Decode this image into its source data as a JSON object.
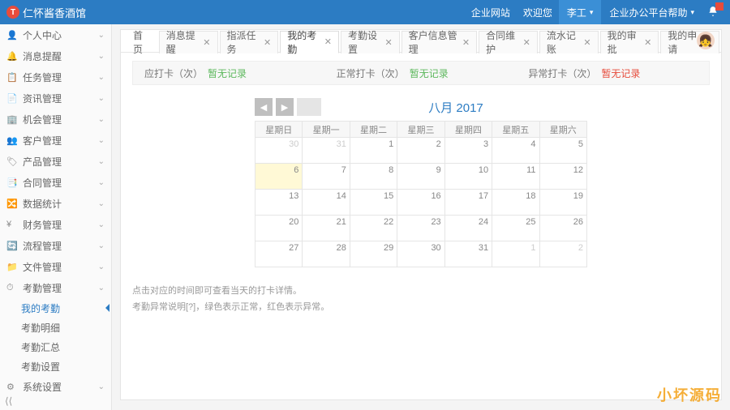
{
  "header": {
    "app_title": "仁怀酱香酒馆",
    "links": [
      "企业网站",
      "欢迎您"
    ],
    "menu1": "李工",
    "menu2": "企业办公平台帮助"
  },
  "sidebar": {
    "items": [
      {
        "icon": "👤",
        "label": "个人中心"
      },
      {
        "icon": "🔔",
        "label": "消息提醒"
      },
      {
        "icon": "📋",
        "label": "任务管理"
      },
      {
        "icon": "📄",
        "label": "资讯管理"
      },
      {
        "icon": "🏢",
        "label": "机会管理"
      },
      {
        "icon": "👥",
        "label": "客户管理"
      },
      {
        "icon": "🏷",
        "label": "产品管理"
      },
      {
        "icon": "📑",
        "label": "合同管理"
      },
      {
        "icon": "🔀",
        "label": "数据统计"
      },
      {
        "icon": "¥",
        "label": "财务管理"
      },
      {
        "icon": "🔄",
        "label": "流程管理"
      },
      {
        "icon": "📁",
        "label": "文件管理"
      },
      {
        "icon": "⏱",
        "label": "考勤管理",
        "open": true,
        "subs": [
          {
            "label": "我的考勤",
            "active": true
          },
          {
            "label": "考勤明细"
          },
          {
            "label": "考勤汇总"
          },
          {
            "label": "考勤设置"
          }
        ]
      },
      {
        "icon": "⚙",
        "label": "系统设置"
      }
    ]
  },
  "tabs": [
    {
      "label": "首页",
      "closable": false
    },
    {
      "label": "消息提醒",
      "closable": true
    },
    {
      "label": "指派任务",
      "closable": true
    },
    {
      "label": "我的考勤",
      "closable": true,
      "active": true
    },
    {
      "label": "考勤设置",
      "closable": true
    },
    {
      "label": "客户信息管理",
      "closable": true
    },
    {
      "label": "合同维护",
      "closable": true
    },
    {
      "label": "流水记账",
      "closable": true
    },
    {
      "label": "我的审批",
      "closable": true
    },
    {
      "label": "我的申请",
      "closable": true
    }
  ],
  "stats": {
    "s1_label": "应打卡（次）",
    "s1_value": "暂无记录",
    "s2_label": "正常打卡（次）",
    "s2_value": "暂无记录",
    "s3_label": "异常打卡（次）",
    "s3_value": "暂无记录"
  },
  "calendar": {
    "title_month": "八月",
    "title_year": "2017",
    "weekdays": [
      "星期日",
      "星期一",
      "星期二",
      "星期三",
      "星期四",
      "星期五",
      "星期六"
    ],
    "rows": [
      [
        {
          "d": "30",
          "o": true
        },
        {
          "d": "31",
          "o": true
        },
        {
          "d": "1"
        },
        {
          "d": "2"
        },
        {
          "d": "3"
        },
        {
          "d": "4"
        },
        {
          "d": "5"
        }
      ],
      [
        {
          "d": "6",
          "today": true
        },
        {
          "d": "7"
        },
        {
          "d": "8"
        },
        {
          "d": "9"
        },
        {
          "d": "10"
        },
        {
          "d": "11"
        },
        {
          "d": "12"
        }
      ],
      [
        {
          "d": "13"
        },
        {
          "d": "14"
        },
        {
          "d": "15"
        },
        {
          "d": "16"
        },
        {
          "d": "17"
        },
        {
          "d": "18"
        },
        {
          "d": "19"
        }
      ],
      [
        {
          "d": "20"
        },
        {
          "d": "21"
        },
        {
          "d": "22"
        },
        {
          "d": "23"
        },
        {
          "d": "24"
        },
        {
          "d": "25"
        },
        {
          "d": "26"
        }
      ],
      [
        {
          "d": "27"
        },
        {
          "d": "28"
        },
        {
          "d": "29"
        },
        {
          "d": "30"
        },
        {
          "d": "31"
        },
        {
          "d": "1",
          "o": true
        },
        {
          "d": "2",
          "o": true
        }
      ]
    ]
  },
  "notes": {
    "line1": "点击对应的时间即可查看当天的打卡详情。",
    "line2": "考勤异常说明[?]，绿色表示正常，红色表示异常。"
  },
  "watermark": "小坏源码"
}
